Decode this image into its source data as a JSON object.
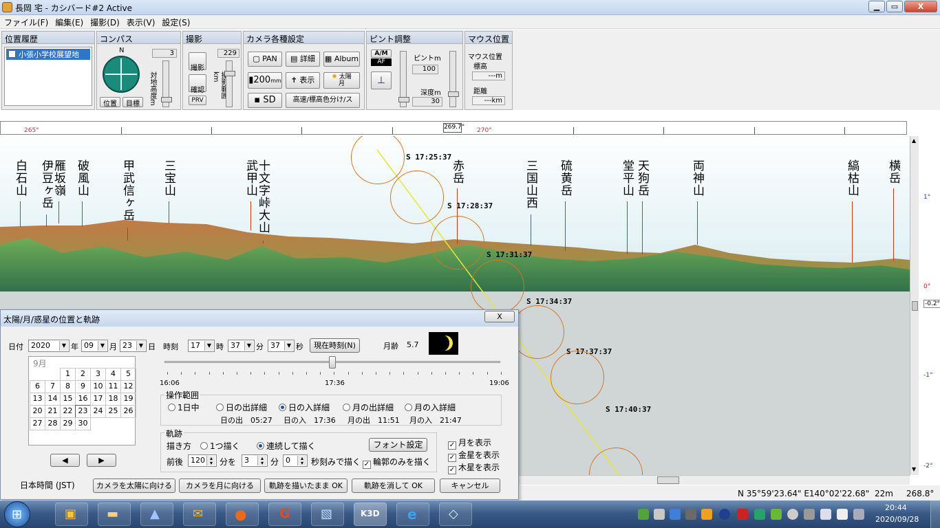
{
  "window": {
    "title": "長岡 宅 - カシバード#2 Active",
    "min_label": "▁",
    "max_label": "▭",
    "close_label": "X"
  },
  "menu": [
    "ファイル(F)",
    "編集(E)",
    "撮影(D)",
    "表示(V)",
    "設定(S)"
  ],
  "panels": {
    "history": {
      "title": "位置履歴",
      "item": "小張小学校展望地"
    },
    "compass": {
      "title": "コンパス",
      "n_label": "N",
      "value": "3",
      "vertical_label": "対地高度m",
      "pos_btn": "位置",
      "target_btn": "目標"
    },
    "shoot": {
      "title": "撮影",
      "shoot_btn": "撮影",
      "confirm_btn": "確認",
      "prv_btn": "PRV",
      "value": "229",
      "vertical_label": "撮影範囲km"
    },
    "camera": {
      "title": "カメラ各種設定",
      "pan": "PAN",
      "detail": "詳細",
      "album": "Album",
      "mm": "200",
      "mm_unit": "mm",
      "display": "表示",
      "sun": "太陽",
      "moon": "月",
      "sd": "SD",
      "elevation": "高速/標高色分け/ス"
    },
    "focus": {
      "title": "ピント調整",
      "am": "A/M",
      "af": "AF",
      "focus_label": "ピントm",
      "focus_value": "100",
      "depth_label": "深度m",
      "depth_value": "30"
    },
    "mouse": {
      "title": "マウス位置",
      "elev_head": "マウス位置",
      "elev_label": "標高",
      "elev_value": "---m",
      "dist_label": "距離",
      "dist_value": "---km"
    }
  },
  "ruler": {
    "left_label": "265°",
    "center_label": "269.7°",
    "right_label": "270°"
  },
  "peaks": [
    {
      "name": "白石山"
    },
    {
      "name": "伊豆ヶ岳"
    },
    {
      "name": "雁坂嶺"
    },
    {
      "name": "破風山"
    },
    {
      "name": "甲武信ヶ岳"
    },
    {
      "name": "三宝山"
    },
    {
      "name": "武甲山"
    },
    {
      "name": "十文字峠大山"
    },
    {
      "name": "赤岳"
    },
    {
      "name": "三国山西"
    },
    {
      "name": "硫黄岳"
    },
    {
      "name": "堂平山"
    },
    {
      "name": "天狗岳"
    },
    {
      "name": "両神山"
    },
    {
      "name": "縞枯山"
    },
    {
      "name": "横岳"
    }
  ],
  "sun_track": [
    "S 17:25:37",
    "S 17:28:37",
    "S 17:31:37",
    "S 17:34:37",
    "S 17:37:37",
    "S 17:40:37"
  ],
  "right_scale": [
    "1°",
    "0°",
    "-0.2°",
    "-1°",
    "-2°"
  ],
  "status": {
    "coords": "N 35°59'23.64\"  E140°02'22.68\"",
    "alt": "22m",
    "dir": "268.8°"
  },
  "dialog": {
    "title": "太陽/月/惑星の位置と軌跡",
    "close": "X",
    "date_label": "日付",
    "year": "2020",
    "year_unit": "年",
    "month": "09",
    "month_unit": "月",
    "day": "23",
    "day_unit": "日",
    "time_label": "時刻",
    "hour": "17",
    "hour_unit": "時",
    "minute": "37",
    "minute_unit": "分",
    "second": "37",
    "second_unit": "秒",
    "now_btn": "現在時刻(N)",
    "moon_age_label": "月齢",
    "moon_age": "5.7",
    "calendar": {
      "month_title": "9月",
      "days": [
        "",
        "",
        "1",
        "2",
        "3",
        "4",
        "5",
        "6",
        "7",
        "8",
        "9",
        "10",
        "11",
        "12",
        "13",
        "14",
        "15",
        "16",
        "17",
        "18",
        "19",
        "20",
        "21",
        "22",
        "23",
        "24",
        "25",
        "26",
        "27",
        "28",
        "29",
        "30"
      ]
    },
    "prev": "◀",
    "next": "▶",
    "time_start": "16:06",
    "time_mid": "17:36",
    "time_end": "19:06",
    "slider_value_fraction": 0.5,
    "range_group": "操作範囲",
    "radios": [
      "1日中",
      "日の出詳細",
      "日の入詳細",
      "月の出詳細",
      "月の入詳細"
    ],
    "rise_set": [
      "日の出　05:27",
      "日の入　17:36",
      "月の出　11:51",
      "月の入　21:47"
    ],
    "track_group": "軌跡",
    "draw_label": "描き方",
    "draw_once": "1つ描く",
    "draw_cont": "連続して描く",
    "font_btn": "フォント設定",
    "before_after": "前後",
    "range_val": "120",
    "range_unit": "分を",
    "step_val": "3",
    "step_unit": "分",
    "sec_val": "0",
    "sec_unit": "秒刻みで描く",
    "outline_only": "輪郭のみを描く",
    "checks": [
      "月を表示",
      "金星を表示",
      "木星を表示"
    ],
    "jst": "日本時間 (JST)",
    "btn_sun": "カメラを太陽に向ける",
    "btn_moon": "カメラを月に向ける",
    "btn_keep": "軌跡を描いたまま OK",
    "btn_clear": "軌跡を消して OK",
    "btn_cancel": "キャンセル"
  },
  "taskbar": {
    "time": "20:44",
    "date": "2020/09/28"
  },
  "colors": {
    "sun_circle": "#d37520",
    "track_line": "#e6e63a",
    "peak_line": "#c23b12",
    "taskbar": "#27456f"
  }
}
